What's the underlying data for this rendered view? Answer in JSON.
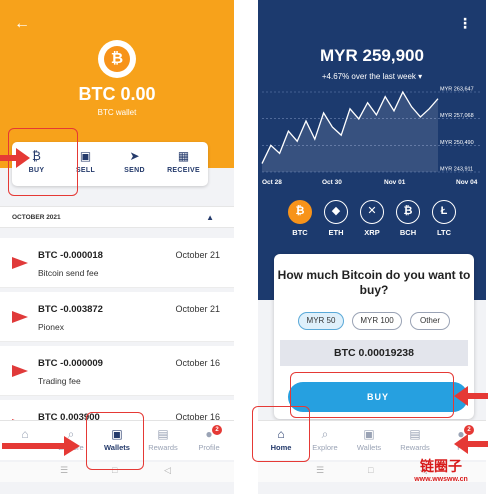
{
  "left": {
    "header": {
      "back_icon": "back-arrow-icon",
      "coin_symbol": "₿",
      "balance": "BTC 0.00",
      "subtitle": "BTC wallet"
    },
    "actions": [
      {
        "label": "BUY",
        "icon": "₿"
      },
      {
        "label": "SELL",
        "icon": "▣"
      },
      {
        "label": "SEND",
        "icon": "➤"
      },
      {
        "label": "RECEIVE",
        "icon": "▦"
      }
    ],
    "month": {
      "label": "OCTOBER 2021",
      "chevron": "▲"
    },
    "transactions": [
      {
        "amount": "BTC -0.000018",
        "desc": "Bitcoin send fee",
        "date": "October 21"
      },
      {
        "amount": "BTC -0.003872",
        "desc": "Pionex",
        "date": "October 21"
      },
      {
        "amount": "BTC -0.000009",
        "desc": "Trading fee",
        "date": "October 16"
      },
      {
        "amount": "BTC 0.003900",
        "desc": "",
        "date": "October 16"
      }
    ],
    "nav": [
      {
        "label": "",
        "icon": "⌂"
      },
      {
        "label": "Explore",
        "icon": "⌕"
      },
      {
        "label": "Wallets",
        "icon": "▣"
      },
      {
        "label": "Rewards",
        "icon": "▤"
      },
      {
        "label": "Profile",
        "icon": "●",
        "badge": "2"
      }
    ],
    "sys_nav": [
      "☰",
      "□",
      "◁"
    ]
  },
  "right": {
    "menu_icon": "⋮",
    "balance": "MYR 259,900",
    "change": "+4.67% over the last week ▾",
    "chart_data": {
      "type": "line",
      "x_ticks": [
        "Oct 28",
        "Oct 30",
        "Nov 01",
        "Nov 04"
      ],
      "y_ticks": [
        "MYR 263,647",
        "MYR 257,068",
        "MYR 250,490",
        "MYR 243,911"
      ],
      "series": [
        {
          "values": [
            246000,
            250500,
            248500,
            254000,
            251500,
            256500,
            252000,
            258500,
            255000,
            253000,
            259500,
            257000,
            261000,
            258000,
            262500,
            259000,
            263647,
            260000,
            257500,
            259500,
            262000
          ]
        }
      ],
      "ylim": [
        243911,
        263647
      ],
      "grid": "horizontal dashed"
    },
    "coins": [
      {
        "label": "BTC",
        "icon": "₿",
        "selected": true
      },
      {
        "label": "ETH",
        "icon": "◆",
        "selected": false
      },
      {
        "label": "XRP",
        "icon": "✕",
        "selected": false
      },
      {
        "label": "BCH",
        "icon": "₿",
        "selected": false
      },
      {
        "label": "LTC",
        "icon": "Ł",
        "selected": false
      }
    ],
    "buy": {
      "question": "How much Bitcoin do you want to buy?",
      "options": [
        {
          "label": "MYR 50",
          "selected": true
        },
        {
          "label": "MYR 100",
          "selected": false
        },
        {
          "label": "Other",
          "selected": false
        }
      ],
      "amount": "BTC 0.00019238",
      "button": "BUY"
    },
    "nav": [
      {
        "label": "Home",
        "icon": "⌂"
      },
      {
        "label": "Explore",
        "icon": "⌕"
      },
      {
        "label": "Wallets",
        "icon": "▣"
      },
      {
        "label": "Rewards",
        "icon": "▤"
      },
      {
        "label": "Pr",
        "icon": "●",
        "badge": "2"
      }
    ],
    "sys_nav": [
      "☰",
      "□",
      "◁"
    ]
  },
  "watermark": {
    "cn": "链圈子",
    "url": "www.wwsww.cn"
  },
  "colors": {
    "orange": "#f7a21b",
    "navy": "#1c3a6e",
    "accent": "#26a0e0",
    "annotation": "#e53935"
  }
}
